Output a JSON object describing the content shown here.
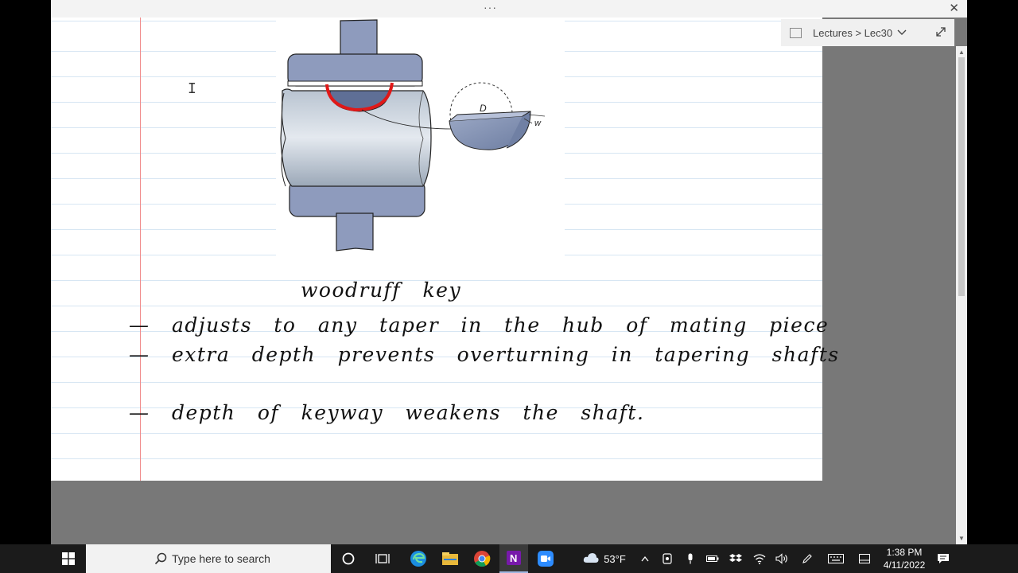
{
  "window": {
    "title_dots": "···",
    "close_glyph": "✕"
  },
  "breadcrumb": {
    "text": "Lectures > Lec30"
  },
  "diagram": {
    "label_d": "D",
    "label_w": "w"
  },
  "notes": {
    "title": "woodruff key",
    "line1": "— adjusts to any taper in the hub of mating piece",
    "line2": "— extra depth prevents overturning in tapering shafts",
    "line3": "— depth of keyway weakens the shaft."
  },
  "taskbar": {
    "search_placeholder": "Type here to search",
    "weather_temp": "53°F",
    "time": "1:38 PM",
    "date": "4/11/2022"
  }
}
